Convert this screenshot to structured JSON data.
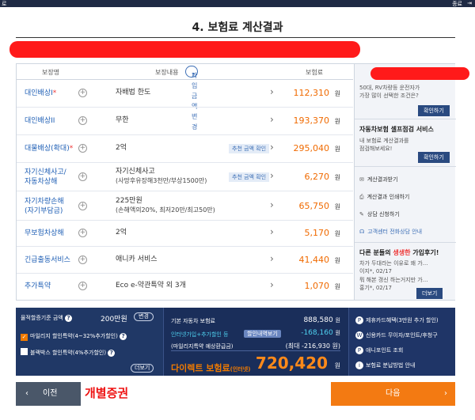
{
  "topbar": {
    "left": "로",
    "right": "종료",
    "exit_icon": "exit-icon"
  },
  "page_title": "4. 보험료 계산결과",
  "table": {
    "headers": {
      "name": "보장명",
      "detail": "보장내용",
      "coverage_btn": "가입금액 변경",
      "premium": "보험료"
    },
    "rows": [
      {
        "name": "대인배상I",
        "req": "*",
        "detail": "자배법 한도",
        "sub": "",
        "recommend": "",
        "price": "112,310",
        "won": "원"
      },
      {
        "name": "대인배상II",
        "req": "",
        "detail": "무한",
        "sub": "",
        "recommend": "",
        "price": "193,370",
        "won": "원"
      },
      {
        "name": "대물배상(확대)",
        "req": "*",
        "detail": "2억",
        "sub": "",
        "recommend": "추천 금액 확인",
        "price": "295,040",
        "won": "원"
      },
      {
        "name": "자기신체사고/",
        "name2": "자동차상해",
        "req": "",
        "detail": "자기신체사고",
        "sub": "(사망후유장해3천만/부상1500만)",
        "recommend": "추천 금액 확인",
        "price": "6,270",
        "won": "원"
      },
      {
        "name": "자기차량손해",
        "name2": "(자기부담금)",
        "req": "",
        "detail": "225만원",
        "sub": "(손해액의20%, 최저20만/최고50만)",
        "recommend": "",
        "price": "65,750",
        "won": "원"
      },
      {
        "name": "무보험차상해",
        "req": "",
        "detail": "2억",
        "sub": "",
        "recommend": "",
        "price": "5,170",
        "won": "원"
      },
      {
        "name": "긴급출동서비스",
        "req": "",
        "detail": "애니카 서비스",
        "sub": "",
        "recommend": "",
        "price": "41,440",
        "won": "원"
      },
      {
        "name": "추가특약",
        "req": "",
        "detail": "Eco e-약관특약 외 3개",
        "sub": "",
        "recommend": "",
        "price": "1,070",
        "won": "원"
      }
    ]
  },
  "side": {
    "promo_line1": "50대, RV차량등 운전자가",
    "promo_line2": "가장 많이 선택한 조건은?",
    "confirm_btn": "확인하기",
    "self_title": "자동차보험 셀프점검 서비스",
    "self_line1": "내 보험료 계산결과를",
    "self_line2": "점검해보세요!",
    "confirm_btn2": "확인하기",
    "links": [
      "계산결과받기",
      "계산결과 인쇄하기",
      "상담 신청하기",
      "고객센터 전화상담 안내"
    ],
    "others_title_pre": "다른 분들의 ",
    "others_title_hl": "생생한",
    "others_title_post": " 가입후기!",
    "review1_a": "차가 두대라는 이유로 왜 가...",
    "review1_b": "이지*, 02/17",
    "review2_a": "뭐 해본 갱신 하는거지만 가...",
    "review2_b": "홍기*, 02/17",
    "more_btn": "더보기"
  },
  "bottom_left": {
    "label": "물적할증기준 금액",
    "amount": "200만원",
    "change_btn": "변경",
    "mileage": "마일리지 할인특약(4~32%추가할인)",
    "blackbox": "블랙박스 할인특약(4%추가할인)",
    "more_btn": "더보기"
  },
  "bottom_mid": {
    "base_label": "기본 자동차 보험료",
    "base_value": "888,580",
    "base_won": "원",
    "disc_label": "인터넷가입+추가할인 등",
    "disc_btn": "할인내역보기",
    "disc_value": "-168,160",
    "disc_won": "원",
    "mileage_label": "(마일리지특약 예상환급금)",
    "mileage_value": "(최대 -216,930 원)",
    "total_label": "다이렉트 보험료",
    "total_small": "(인터넷)",
    "total_value": "720,420",
    "total_won": "원"
  },
  "bottom_right": {
    "items": [
      "제휴카드혜택(3만원 추가 할인)",
      "신용카드 무이자/포인트/후청구",
      "애니포인트 조회",
      "보험료 분납방법 안내"
    ],
    "icons": [
      "P",
      "W",
      "P",
      "i"
    ]
  },
  "nav": {
    "prev_arrow": "‹",
    "prev": "이전",
    "broker": "개별증권",
    "next": "다음",
    "next_arrow": "›"
  },
  "colors": {
    "accent_orange": "#f37a12",
    "navy": "#1a2e5a",
    "link_blue": "#1f5fb5",
    "redact": "#ff1a1a"
  }
}
